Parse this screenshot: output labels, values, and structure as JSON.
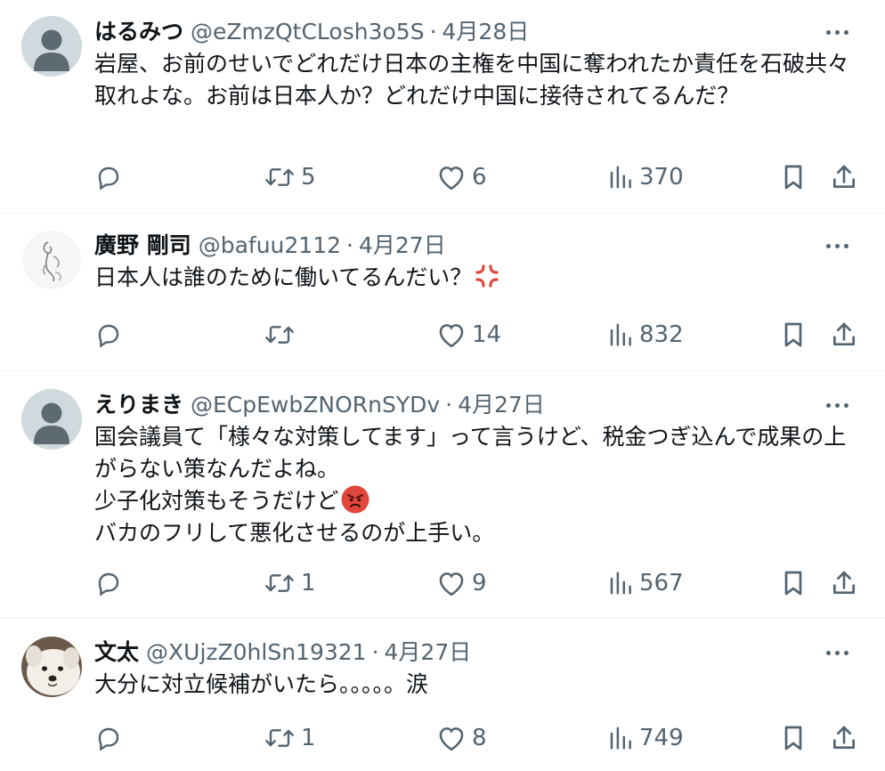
{
  "tweets": [
    {
      "name": "はるみつ",
      "handle": "@eZmzQtCLosh3o5S",
      "separator": "·",
      "date": "4月28日",
      "avatar": "default-avatar",
      "text": "岩屋、お前のせいでどれだけ日本の主権を中国に奪われたか責任を石破共々取れよな。お前は日本人か？どれだけ中国に接待されてるんだ？",
      "retweets": "5",
      "likes": "6",
      "views": "370"
    },
    {
      "name": "廣野 剛司",
      "handle": "@bafuu2112",
      "separator": "·",
      "date": "4月27日",
      "avatar": "sketch-avatar",
      "text": "日本人は誰のために働いてるんだい？",
      "emoji": "anger-symbol-emoji",
      "retweets": "",
      "likes": "14",
      "views": "832"
    },
    {
      "name": "えりまき",
      "handle": "@ECpEwbZNORnSYDv",
      "separator": "·",
      "date": "4月27日",
      "avatar": "default-avatar",
      "text_lines": [
        "国会議員て「様々な対策してます」って言うけど、税金つぎ込んで成果の上がらない策なんだよね。",
        "少子化対策もそうだけど",
        "バカのフリして悪化させるのが上手い。"
      ],
      "emoji": "angry-face-emoji",
      "retweets": "1",
      "likes": "9",
      "views": "567"
    },
    {
      "name": "文太",
      "handle": "@XUjzZ0hlSn19321",
      "separator": "·",
      "date": "4月27日",
      "avatar": "dog-photo-avatar",
      "text": "大分に対立候補がいたら。。。。。涙",
      "retweets": "1",
      "likes": "8",
      "views": "749"
    }
  ],
  "colors": {
    "text": "#0f1419",
    "secondary": "#536471",
    "divider": "#eff3f4",
    "default_avatar_bg": "#cfd9de",
    "anger_red": "#e0463b"
  },
  "icons": {
    "reply": "reply-icon",
    "retweet": "retweet-icon",
    "like": "heart-icon",
    "views": "views-bar-chart-icon",
    "bookmark": "bookmark-icon",
    "share": "share-icon",
    "more": "more-dots-icon"
  }
}
